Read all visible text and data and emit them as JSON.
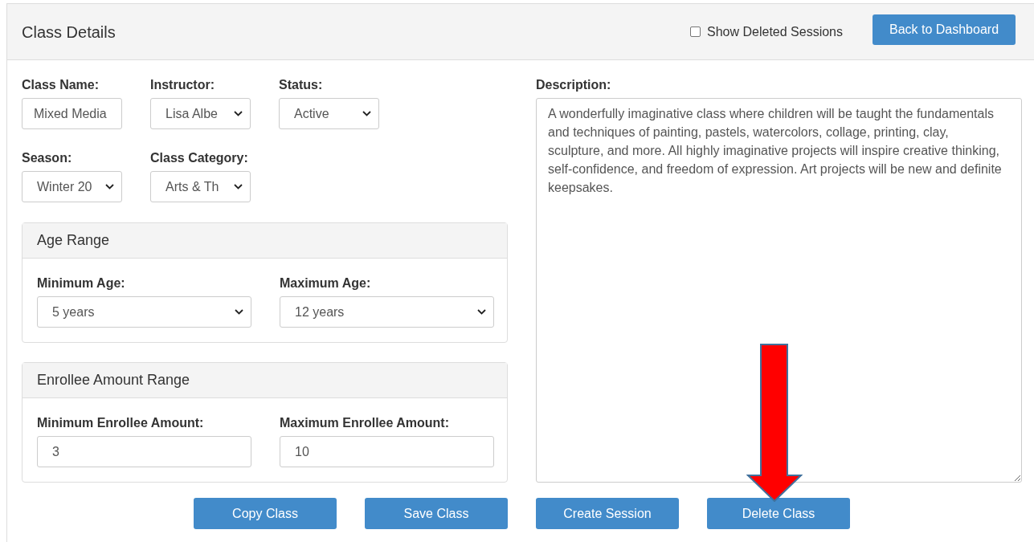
{
  "header": {
    "title": "Class Details",
    "show_deleted": {
      "label": "Show Deleted Sessions",
      "checked": false
    },
    "back_button": "Back to Dashboard"
  },
  "fields": [
    {
      "kind": "text",
      "label": "Class Name:",
      "value": "Mixed Media"
    },
    {
      "kind": "select",
      "label": "Instructor:",
      "value": "Lisa Albe"
    },
    {
      "kind": "select",
      "label": "Status:",
      "value": "Active"
    },
    {
      "kind": "select",
      "label": "Season:",
      "value": "Winter 20"
    },
    {
      "kind": "select",
      "label": "Class Category:",
      "value": "Arts & Th"
    }
  ],
  "panels": [
    {
      "title": "Age Range",
      "fields": [
        {
          "kind": "select",
          "label": "Minimum Age:",
          "value": "5 years"
        },
        {
          "kind": "select",
          "label": "Maximum Age:",
          "value": "12 years"
        }
      ]
    },
    {
      "title": "Enrollee Amount Range",
      "fields": [
        {
          "kind": "text",
          "label": "Minimum Enrollee Amount:",
          "value": "3"
        },
        {
          "kind": "text",
          "label": "Maximum Enrollee Amount:",
          "value": "10"
        }
      ]
    }
  ],
  "description": {
    "label": "Description:",
    "value": "A wonderfully imaginative class where children will be taught the fundamentals and techniques of painting, pastels, watercolors, collage, printing, clay, sculpture, and more. All highly imaginative projects will inspire creative thinking, self-confidence, and freedom of expression. Art projects will be new and definite keepsakes."
  },
  "buttons": [
    "Copy Class",
    "Save Class",
    "Create Session",
    "Delete Class"
  ]
}
